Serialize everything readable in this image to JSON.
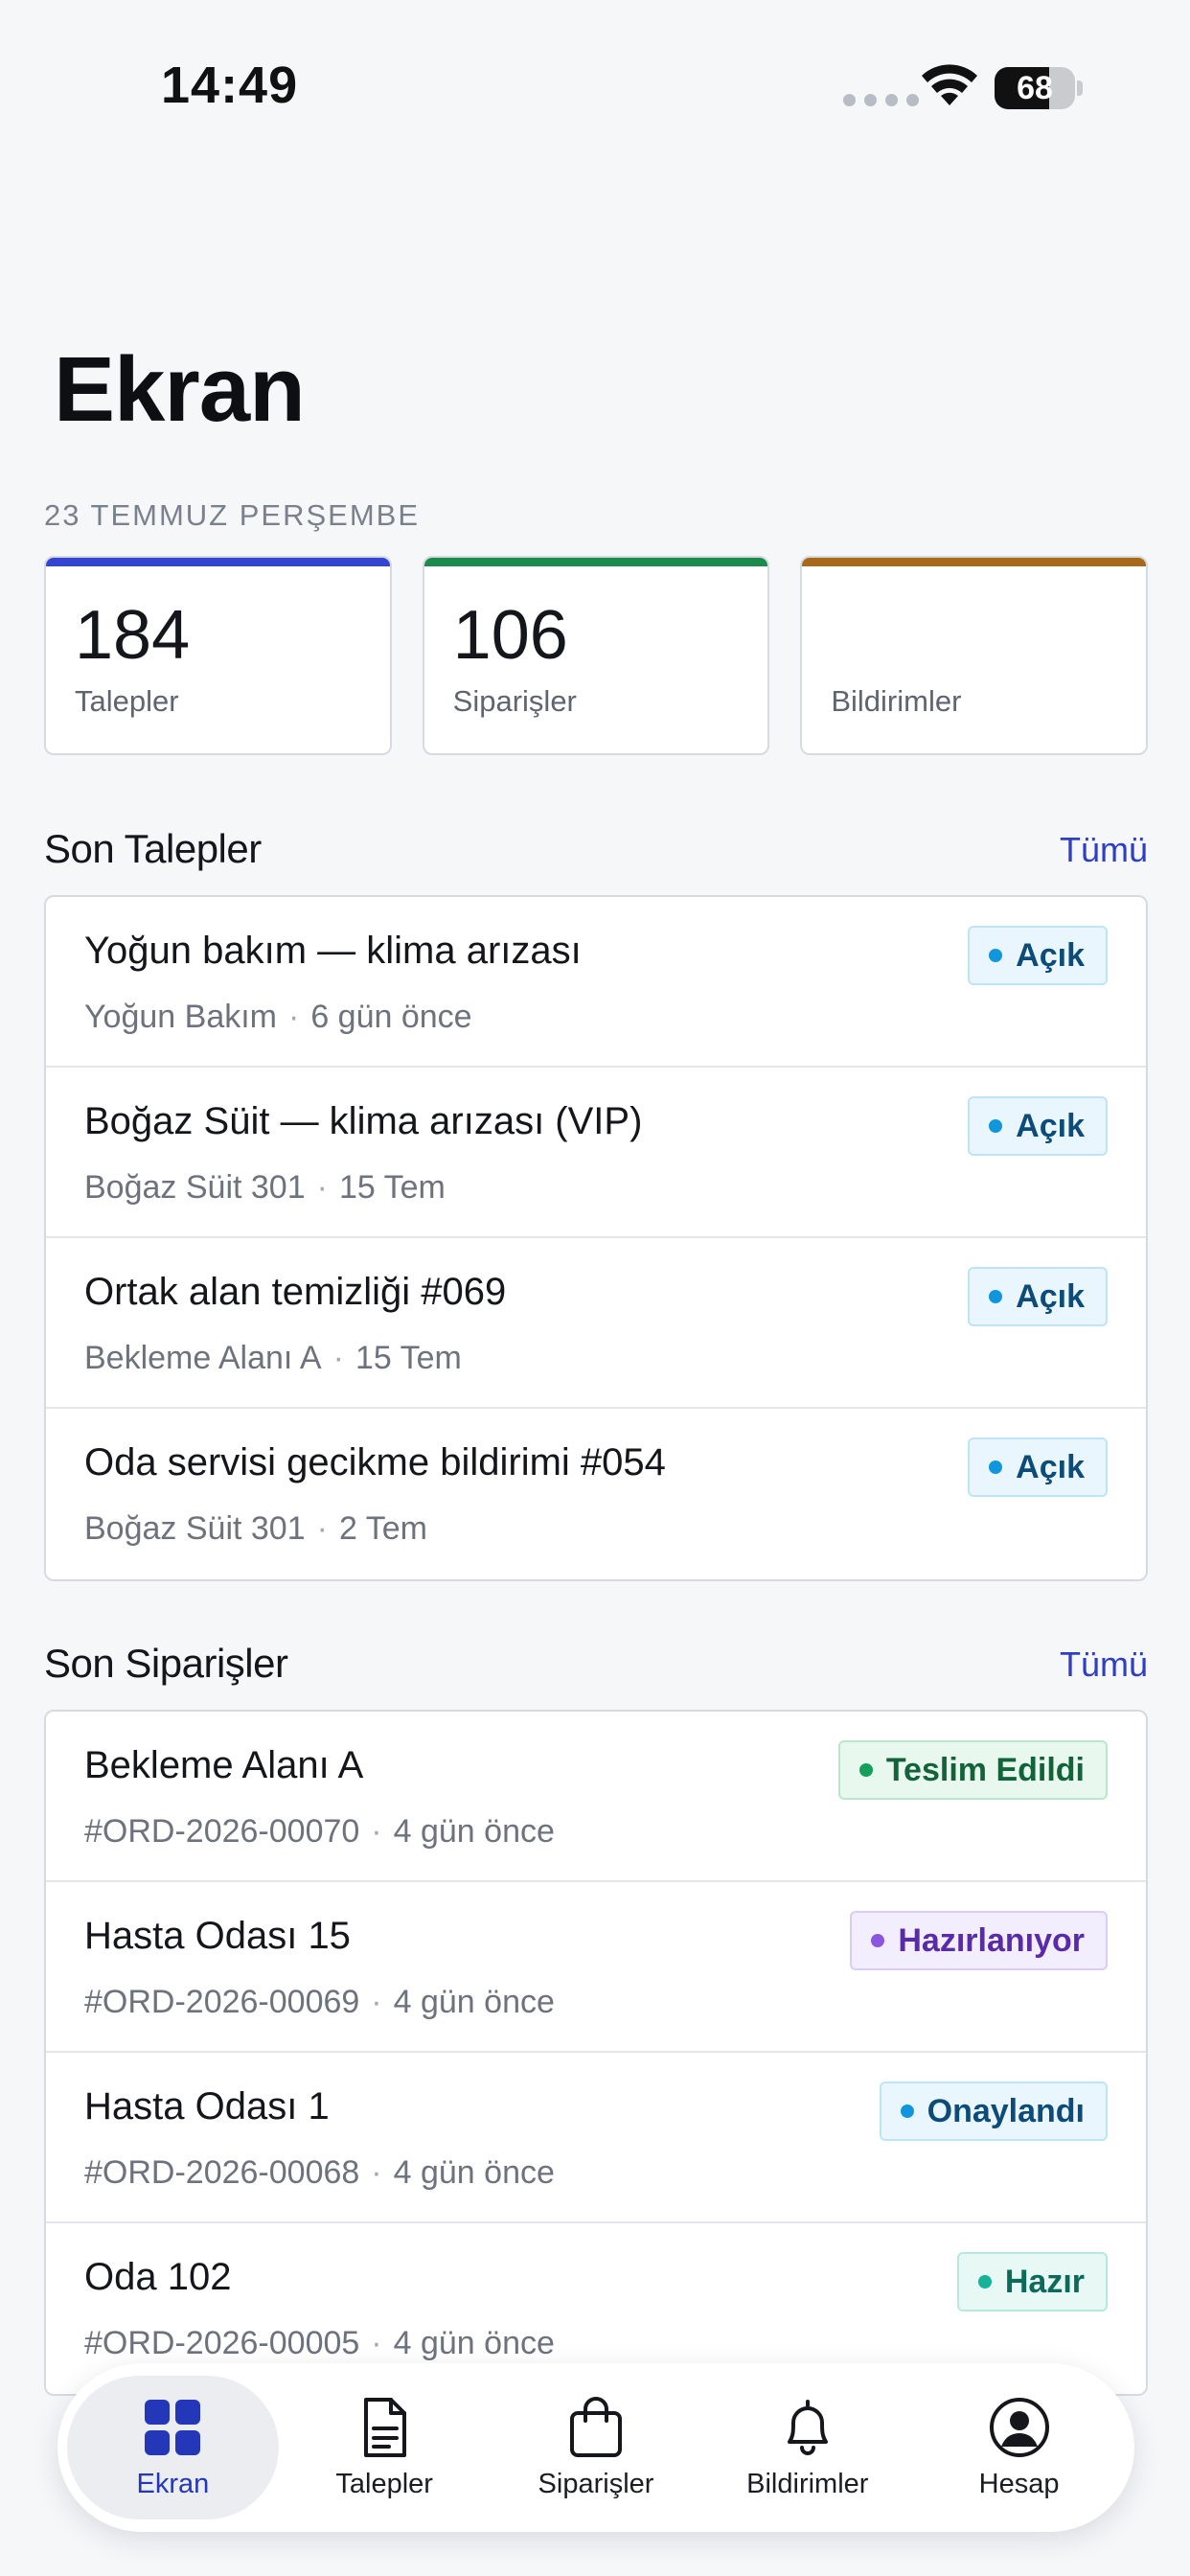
{
  "status_bar": {
    "time": "14:49",
    "battery": "68",
    "battery_level": 0.68
  },
  "header": {
    "title": "Ekran",
    "date": "23 TEMMUZ PERŞEMBE"
  },
  "stats": [
    {
      "value": "184",
      "label": "Talepler",
      "accent": "#3346d3"
    },
    {
      "value": "106",
      "label": "Siparişler",
      "accent": "#1c8a4a"
    },
    {
      "value": "",
      "label": "Bildirimler",
      "accent": "#a8691b"
    }
  ],
  "requests": {
    "title": "Son Talepler",
    "link": "Tümü",
    "items": [
      {
        "title": "Yoğun bakım — klima arızası",
        "location": "Yoğun Bakım",
        "time": "6 gün önce",
        "status": "Açık"
      },
      {
        "title": "Boğaz Süit — klima arızası (VIP)",
        "location": "Boğaz Süit 301",
        "time": "15 Tem",
        "status": "Açık"
      },
      {
        "title": "Ortak alan temizliği #069",
        "location": "Bekleme Alanı A",
        "time": "15 Tem",
        "status": "Açık"
      },
      {
        "title": "Oda servisi gecikme bildirimi #054",
        "location": "Boğaz Süit 301",
        "time": "2 Tem",
        "status": "Açık"
      }
    ]
  },
  "orders": {
    "title": "Son Siparişler",
    "link": "Tümü",
    "items": [
      {
        "title": "Bekleme Alanı A",
        "code": "#ORD-2026-00070",
        "time": "4 gün önce",
        "status": "Teslim Edildi"
      },
      {
        "title": "Hasta Odası 15",
        "code": "#ORD-2026-00069",
        "time": "4 gün önce",
        "status": "Hazırlanıyor"
      },
      {
        "title": "Hasta Odası 1",
        "code": "#ORD-2026-00068",
        "time": "4 gün önce",
        "status": "Onaylandı"
      },
      {
        "title": "Oda 102",
        "code": "#ORD-2026-00005",
        "time": "4 gün önce",
        "status": "Hazır"
      }
    ]
  },
  "tabs": [
    {
      "label": "Ekran",
      "icon": "grid-icon"
    },
    {
      "label": "Talepler",
      "icon": "document-icon"
    },
    {
      "label": "Siparişler",
      "icon": "bag-icon"
    },
    {
      "label": "Bildirimler",
      "icon": "bell-icon"
    },
    {
      "label": "Hesap",
      "icon": "account-icon"
    }
  ],
  "colors": {
    "accent": "#2437b8",
    "link": "#2e3fc4"
  }
}
